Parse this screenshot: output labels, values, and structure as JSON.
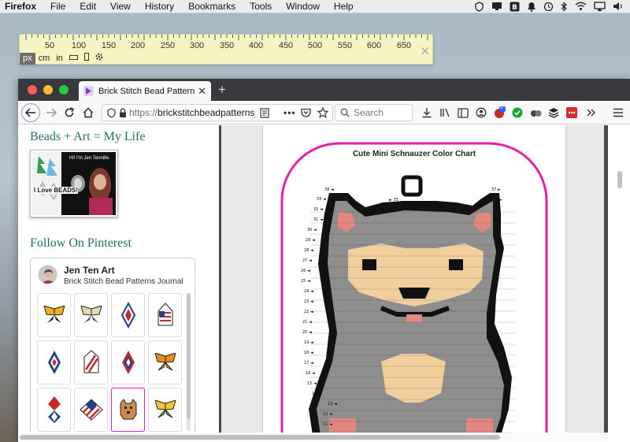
{
  "menubar": {
    "app_name": "Firefox",
    "items": [
      "File",
      "Edit",
      "View",
      "History",
      "Bookmarks",
      "Tools",
      "Window",
      "Help"
    ]
  },
  "ruler": {
    "numbers": [
      "50",
      "100",
      "150",
      "200",
      "250",
      "300",
      "350",
      "400",
      "450",
      "500",
      "550",
      "600",
      "650"
    ],
    "units": [
      "px",
      "cm",
      "in"
    ],
    "active_unit": "px"
  },
  "browser": {
    "tab_title": "Brick Stitch Bead Patterns Journal",
    "url_protocol": "https://",
    "url_host": "brickstitchbeadpatternsjournal.com",
    "search_placeholder": "Search",
    "notification_badge": "0"
  },
  "sidebar": {
    "heading": "Beads + Art = My Life",
    "banner_greeting": "Hi! I'm Jen Tennille.",
    "banner_love_text": "I Love BEADS!",
    "pinterest_heading": "Follow On Pinterest",
    "pinterest_name": "Jen Ten Art",
    "pinterest_board": "Brick Stitch Bead Patterns Journal",
    "pins": [
      "butterfly-pattern",
      "butterfly-pattern",
      "diamond-pattern",
      "flag-pattern",
      "diamond-pattern",
      "flag-pattern",
      "diamond-pattern",
      "butterfly-pattern",
      "diamond-pattern",
      "flag-pattern",
      "dog-pattern",
      "butterfly-pattern"
    ]
  },
  "document": {
    "title": "Cute Mini Schnauzer Color Chart",
    "border_color": "#e91ea9"
  }
}
